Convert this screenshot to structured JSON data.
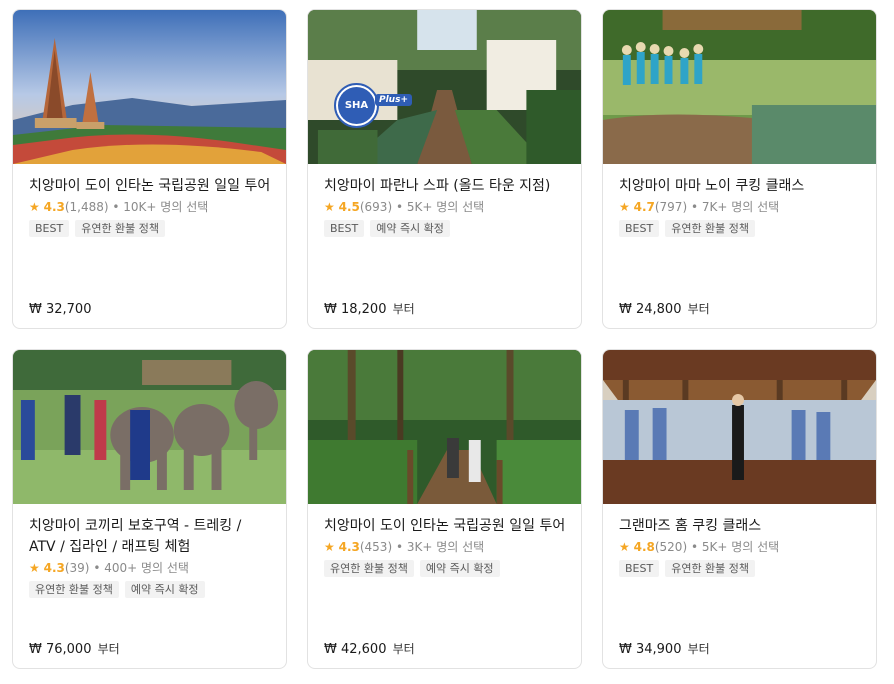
{
  "colors": {
    "accent_star": "#f5a623",
    "tag_bg": "#f2f2f2",
    "badge_blue": "#2f5db5"
  },
  "cards": [
    {
      "title": "치앙마이 도이 인타논 국립공원 일일 투어",
      "star": "★",
      "rating": "4.3",
      "reviews": "(1,488)",
      "chosen": " • 10K+ 명의 선택",
      "tags": [
        "BEST",
        "유연한 환불 정책"
      ],
      "price": "₩ 32,700",
      "price_suffix": ""
    },
    {
      "title": "치앙마이 파란나 스파 (올드 타운 지점)",
      "star": "★",
      "rating": "4.5",
      "reviews": "(693)",
      "chosen": " • 5K+ 명의 선택",
      "tags": [
        "BEST",
        "예약 즉시 확정"
      ],
      "price": "₩ 18,200",
      "price_suffix": "부터",
      "badge": {
        "text": "SHA",
        "plus": "Plus+"
      }
    },
    {
      "title": "치앙마이 마마 노이 쿠킹 클래스",
      "star": "★",
      "rating": "4.7",
      "reviews": "(797)",
      "chosen": " • 7K+ 명의 선택",
      "tags": [
        "BEST",
        "유연한 환불 정책"
      ],
      "price": "₩ 24,800",
      "price_suffix": "부터"
    },
    {
      "title": "치앙마이 코끼리 보호구역 - 트레킹 / ATV / 집라인 / 래프팅 체험",
      "star": "★",
      "rating": "4.3",
      "reviews": "(39)",
      "chosen": " • 400+ 명의 선택",
      "tags": [
        "유연한 환불 정책",
        "예약 즉시 확정"
      ],
      "price": "₩ 76,000",
      "price_suffix": "부터"
    },
    {
      "title": "치앙마이 도이 인타논 국립공원 일일 투어",
      "star": "★",
      "rating": "4.3",
      "reviews": "(453)",
      "chosen": " • 3K+ 명의 선택",
      "tags": [
        "유연한 환불 정책",
        "예약 즉시 확정"
      ],
      "price": "₩ 42,600",
      "price_suffix": "부터"
    },
    {
      "title": "그랜마즈 홈 쿠킹 클래스",
      "star": "★",
      "rating": "4.8",
      "reviews": "(520)",
      "chosen": " • 5K+ 명의 선택",
      "tags": [
        "BEST",
        "유연한 환불 정책"
      ],
      "price": "₩ 34,900",
      "price_suffix": "부터"
    }
  ]
}
